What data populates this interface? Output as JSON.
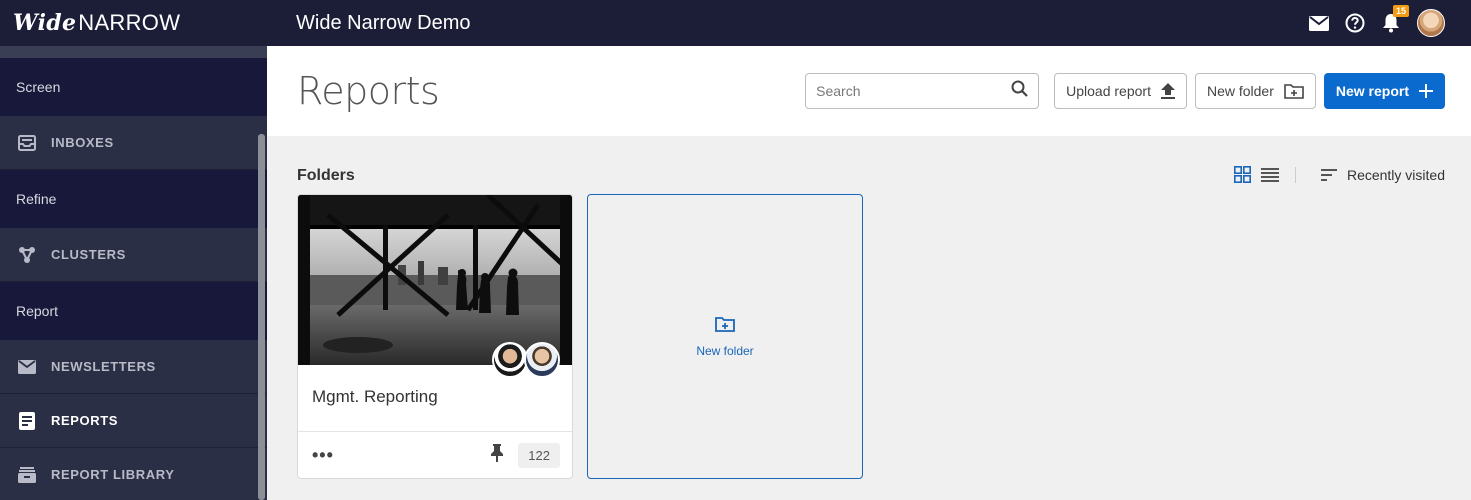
{
  "brand": {
    "wide": "Wide",
    "narrow": "NARROW"
  },
  "topbar": {
    "title": "Wide Narrow Demo",
    "notification_count": "15"
  },
  "sidebar": {
    "sections": [
      {
        "title": "Screen",
        "items": [
          {
            "label": "INBOXES",
            "icon": "inbox-icon"
          }
        ]
      },
      {
        "title": "Refine",
        "items": [
          {
            "label": "CLUSTERS",
            "icon": "clusters-icon"
          }
        ]
      },
      {
        "title": "Report",
        "items": [
          {
            "label": "NEWSLETTERS",
            "icon": "mail-icon"
          },
          {
            "label": "REPORTS",
            "icon": "report-icon",
            "active": true
          },
          {
            "label": "REPORT LIBRARY",
            "icon": "library-icon"
          }
        ]
      }
    ]
  },
  "header": {
    "title": "Reports",
    "search_placeholder": "Search",
    "upload_label": "Upload report",
    "new_folder_label": "New folder",
    "new_report_label": "New report"
  },
  "content": {
    "folders_label": "Folders",
    "sort_label": "Recently visited",
    "folders": [
      {
        "name": "Mgmt. Reporting",
        "count": "122"
      }
    ],
    "new_folder_label": "New folder"
  },
  "colors": {
    "accent": "#0a6acd",
    "sidebar": "#2b2f45",
    "topbar": "#1c1e38",
    "badge": "#f39c12"
  }
}
